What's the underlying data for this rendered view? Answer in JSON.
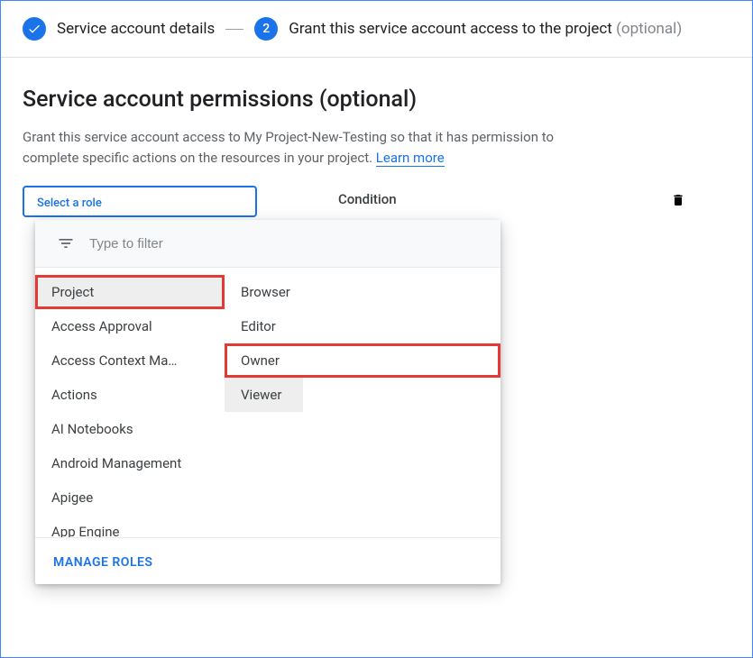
{
  "stepper": {
    "step1_label": "Service account details",
    "step2_num": "2",
    "step2_label": "Grant this service account access to the project",
    "step2_optional": "(optional)"
  },
  "page": {
    "title": "Service account permissions (optional)",
    "description": "Grant this service account access to My Project-New-Testing so that it has permission to complete specific actions on the resources in your project. ",
    "learn_more": "Learn more"
  },
  "role_selector": {
    "label": "Select a role",
    "condition_label": "Condition"
  },
  "dropdown": {
    "filter_placeholder": "Type to filter",
    "categories": [
      "Project",
      "Access Approval",
      "Access Context Ma…",
      "Actions",
      "AI Notebooks",
      "Android Management",
      "Apigee",
      "App Engine"
    ],
    "roles": [
      "Browser",
      "Editor",
      "Owner",
      "Viewer"
    ],
    "manage_roles_label": "MANAGE ROLES"
  }
}
